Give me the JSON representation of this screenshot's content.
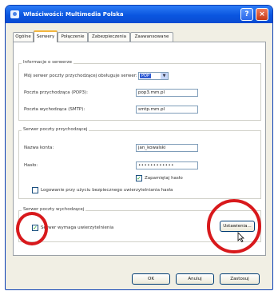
{
  "window": {
    "title": "Właściwości: Multimedia Polska",
    "help_symbol": "?",
    "close_symbol": "×",
    "icon": "account-icon"
  },
  "tabs": [
    {
      "label": "Ogólne",
      "active": false
    },
    {
      "label": "Serwery",
      "active": true
    },
    {
      "label": "Połączenie",
      "active": false
    },
    {
      "label": "Zabezpieczenia",
      "active": false
    },
    {
      "label": "Zaawansowane",
      "active": false
    }
  ],
  "server_info": {
    "group_label": "Informacje o serwerze",
    "incoming_type_label": "Mój serwer poczty przychodzącej obsługuje serwer:",
    "incoming_type_value": "POP",
    "pop3_label": "Poczta przychodząca (POP3):",
    "pop3_value": "pop3.mm.pl",
    "smtp_label": "Poczta wychodząca (SMTP):",
    "smtp_value": "smtp.mm.pl"
  },
  "incoming": {
    "group_label": "Serwer poczty przychodzącej",
    "account_label": "Nazwa konta:",
    "account_value": "jan_kowalski",
    "password_label": "Hasło:",
    "password_value": "••••••••••••",
    "remember_label": "Zapamiętaj hasło",
    "remember_checked": true,
    "spa_label": "Logowanie przy użyciu bezpiecznego uwierzytelniania hasła",
    "spa_checked": false
  },
  "outgoing": {
    "group_label": "Serwer poczty wychodzącej",
    "auth_label": "Serwer wymaga uwierzytelnienia",
    "auth_checked": true,
    "settings_button": "Ustawienia..."
  },
  "footer": {
    "ok": "OK",
    "cancel": "Anuluj",
    "apply": "Zastosuj"
  },
  "colors": {
    "highlight_circle": "#d8191c",
    "titlebar": "#0a56e0",
    "check": "#21a121"
  }
}
